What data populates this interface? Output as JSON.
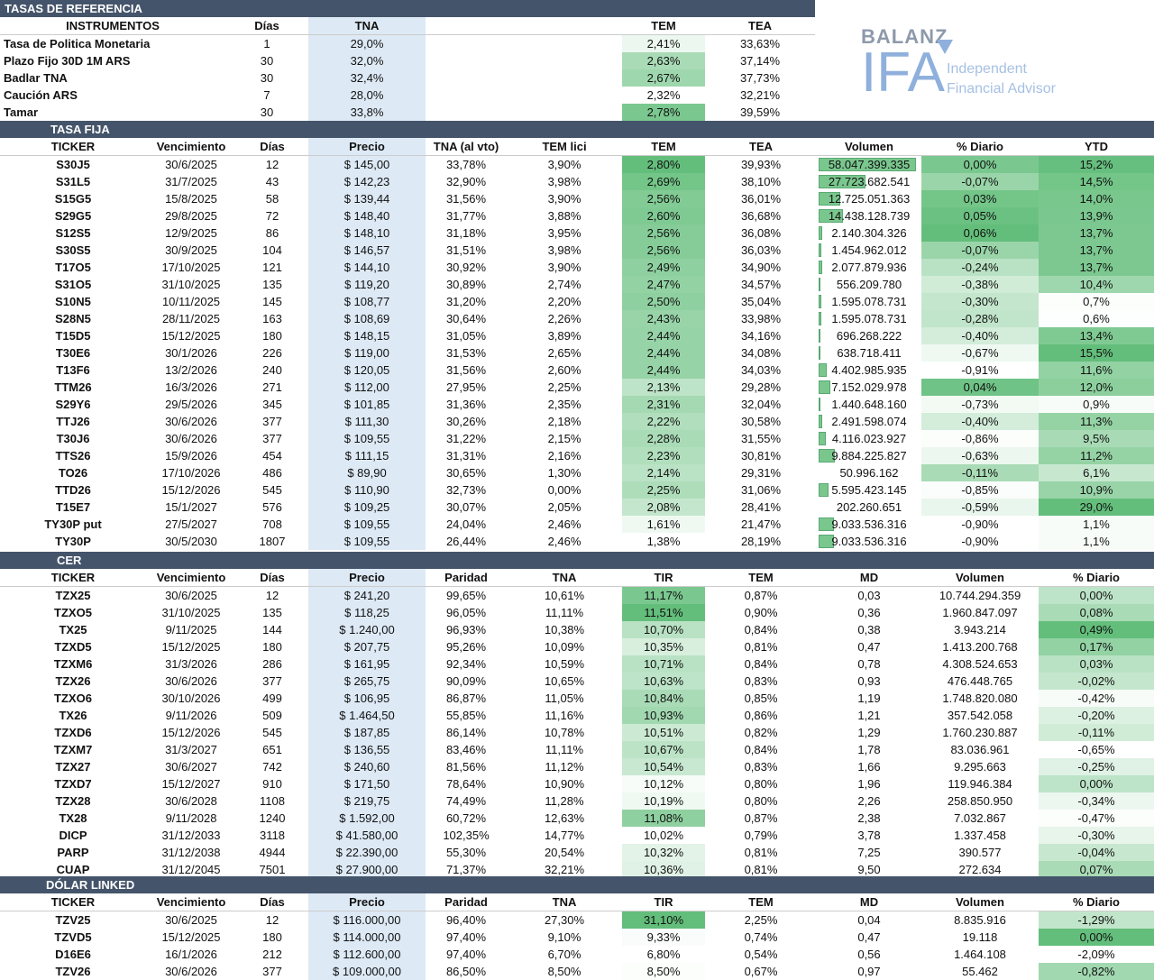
{
  "logo": {
    "brand": "BALANZ",
    "name": "IFA",
    "tagline1": "Independent",
    "tagline2": "Financial Advisor"
  },
  "ref": {
    "title": "TASAS DE REFERENCIA",
    "headers": [
      "INSTRUMENTOS",
      "Días",
      "TNA",
      "",
      "TEM",
      "TEA"
    ],
    "rows": [
      [
        "Tasa de Politica Monetaria",
        "1",
        "29,0%",
        "",
        "2,41%",
        "33,63%"
      ],
      [
        "Plazo Fijo 30D 1M ARS",
        "30",
        "32,0%",
        "",
        "2,63%",
        "37,14%"
      ],
      [
        "Badlar TNA",
        "30",
        "32,4%",
        "",
        "2,67%",
        "37,73%"
      ],
      [
        "Caución ARS",
        "7",
        "28,0%",
        "",
        "2,32%",
        "32,21%"
      ],
      [
        "Tamar",
        "30",
        "33,8%",
        "",
        "2,78%",
        "39,59%"
      ]
    ],
    "tem_shade": [
      0.12,
      0.55,
      0.62,
      0.0,
      0.85
    ]
  },
  "fija": {
    "title": "TASA FIJA",
    "headers": [
      "TICKER",
      "Vencimiento",
      "Días",
      "Precio",
      "TNA (al vto)",
      "TEM lici",
      "TEM",
      "TEA",
      "Volumen",
      "% Diario",
      "YTD"
    ],
    "rows": [
      [
        "S30J5",
        "30/6/2025",
        "12",
        "$ 145,00",
        "33,78%",
        "3,90%",
        "2,80%",
        "39,93%",
        "58.047.399.335",
        "0,00%",
        "15,2%"
      ],
      [
        "S31L5",
        "31/7/2025",
        "43",
        "$ 142,23",
        "32,90%",
        "3,98%",
        "2,69%",
        "38,10%",
        "27.723.682.541",
        "-0,07%",
        "14,5%"
      ],
      [
        "S15G5",
        "15/8/2025",
        "58",
        "$ 139,44",
        "31,56%",
        "3,90%",
        "2,56%",
        "36,01%",
        "12.725.051.363",
        "0,03%",
        "14,0%"
      ],
      [
        "S29G5",
        "29/8/2025",
        "72",
        "$ 148,40",
        "31,77%",
        "3,88%",
        "2,60%",
        "36,68%",
        "14.438.128.739",
        "0,05%",
        "13,9%"
      ],
      [
        "S12S5",
        "12/9/2025",
        "86",
        "$ 148,10",
        "31,18%",
        "3,95%",
        "2,56%",
        "36,08%",
        "2.140.304.326",
        "0,06%",
        "13,7%"
      ],
      [
        "S30S5",
        "30/9/2025",
        "104",
        "$ 146,57",
        "31,51%",
        "3,98%",
        "2,56%",
        "36,03%",
        "1.454.962.012",
        "-0,07%",
        "13,7%"
      ],
      [
        "T17O5",
        "17/10/2025",
        "121",
        "$ 144,10",
        "30,92%",
        "3,90%",
        "2,49%",
        "34,90%",
        "2.077.879.936",
        "-0,24%",
        "13,7%"
      ],
      [
        "S31O5",
        "31/10/2025",
        "135",
        "$ 119,20",
        "30,89%",
        "2,74%",
        "2,47%",
        "34,57%",
        "556.209.780",
        "-0,38%",
        "10,4%"
      ],
      [
        "S10N5",
        "10/11/2025",
        "145",
        "$ 108,77",
        "31,20%",
        "2,20%",
        "2,50%",
        "35,04%",
        "1.595.078.731",
        "-0,30%",
        "0,7%"
      ],
      [
        "S28N5",
        "28/11/2025",
        "163",
        "$ 108,69",
        "30,64%",
        "2,26%",
        "2,43%",
        "33,98%",
        "1.595.078.731",
        "-0,28%",
        "0,6%"
      ],
      [
        "T15D5",
        "15/12/2025",
        "180",
        "$ 148,15",
        "31,05%",
        "3,89%",
        "2,44%",
        "34,16%",
        "696.268.222",
        "-0,40%",
        "13,4%"
      ],
      [
        "T30E6",
        "30/1/2026",
        "226",
        "$ 119,00",
        "31,53%",
        "2,65%",
        "2,44%",
        "34,08%",
        "638.718.411",
        "-0,67%",
        "15,5%"
      ],
      [
        "T13F6",
        "13/2/2026",
        "240",
        "$ 120,05",
        "31,56%",
        "2,60%",
        "2,44%",
        "34,03%",
        "4.402.985.935",
        "-0,91%",
        "11,6%"
      ],
      [
        "TTM26",
        "16/3/2026",
        "271",
        "$ 112,00",
        "27,95%",
        "2,25%",
        "2,13%",
        "29,28%",
        "7.152.029.978",
        "0,04%",
        "12,0%"
      ],
      [
        "S29Y6",
        "29/5/2026",
        "345",
        "$ 101,85",
        "31,36%",
        "2,35%",
        "2,31%",
        "32,04%",
        "1.440.648.160",
        "-0,73%",
        "0,9%"
      ],
      [
        "TTJ26",
        "30/6/2026",
        "377",
        "$ 111,30",
        "30,26%",
        "2,18%",
        "2,22%",
        "30,58%",
        "2.491.598.074",
        "-0,40%",
        "11,3%"
      ],
      [
        "T30J6",
        "30/6/2026",
        "377",
        "$ 109,55",
        "31,22%",
        "2,15%",
        "2,28%",
        "31,55%",
        "4.116.023.927",
        "-0,86%",
        "9,5%"
      ],
      [
        "TTS26",
        "15/9/2026",
        "454",
        "$ 111,15",
        "31,31%",
        "2,16%",
        "2,23%",
        "30,81%",
        "9.884.225.827",
        "-0,63%",
        "11,2%"
      ],
      [
        "TO26",
        "17/10/2026",
        "486",
        "$ 89,90",
        "30,65%",
        "1,30%",
        "2,14%",
        "29,31%",
        "50.996.162",
        "-0,11%",
        "6,1%"
      ],
      [
        "TTD26",
        "15/12/2026",
        "545",
        "$ 110,90",
        "32,73%",
        "0,00%",
        "2,25%",
        "31,06%",
        "5.595.423.145",
        "-0,85%",
        "10,9%"
      ],
      [
        "T15E7",
        "15/1/2027",
        "576",
        "$ 109,25",
        "30,07%",
        "2,05%",
        "2,08%",
        "28,41%",
        "202.260.651",
        "-0,59%",
        "29,0%"
      ],
      [
        "TY30P put",
        "27/5/2027",
        "708",
        "$ 109,55",
        "24,04%",
        "2,46%",
        "1,61%",
        "21,47%",
        "9.033.536.316",
        "-0,90%",
        "1,1%"
      ],
      [
        "TY30P",
        "30/5/2030",
        "1807",
        "$ 109,55",
        "26,44%",
        "2,46%",
        "1,38%",
        "28,19%",
        "9.033.536.316",
        "-0,90%",
        "1,1%"
      ]
    ],
    "tem_shade": [
      1.0,
      0.9,
      0.8,
      0.82,
      0.78,
      0.78,
      0.72,
      0.7,
      0.72,
      0.66,
      0.67,
      0.67,
      0.67,
      0.42,
      0.58,
      0.5,
      0.55,
      0.5,
      0.44,
      0.52,
      0.38,
      0.1,
      0.0
    ],
    "vol_frac": [
      1.0,
      0.48,
      0.22,
      0.25,
      0.04,
      0.03,
      0.04,
      0.01,
      0.03,
      0.03,
      0.01,
      0.01,
      0.08,
      0.12,
      0.02,
      0.04,
      0.07,
      0.17,
      0.0,
      0.1,
      0.0,
      0.16,
      0.16
    ],
    "diario_shade": [
      0.85,
      0.65,
      0.9,
      0.95,
      1.0,
      0.65,
      0.45,
      0.3,
      0.38,
      0.4,
      0.28,
      0.1,
      0.0,
      0.92,
      0.08,
      0.28,
      0.02,
      0.12,
      0.55,
      0.03,
      0.14,
      0.0,
      0.0
    ],
    "ytd_shade": [
      0.98,
      0.9,
      0.86,
      0.85,
      0.84,
      0.84,
      0.84,
      0.62,
      0.02,
      0.01,
      0.82,
      1.0,
      0.7,
      0.74,
      0.05,
      0.68,
      0.56,
      0.68,
      0.36,
      0.66,
      1.0,
      0.05,
      0.05
    ]
  },
  "cer": {
    "title": "CER",
    "headers": [
      "TICKER",
      "Vencimiento",
      "Días",
      "Precio",
      "Paridad",
      "TNA",
      "TIR",
      "TEM",
      "MD",
      "Volumen",
      "% Diario"
    ],
    "rows": [
      [
        "TZX25",
        "30/6/2025",
        "12",
        "$ 241,20",
        "99,65%",
        "10,61%",
        "11,17%",
        "0,87%",
        "0,03",
        "10.744.294.359",
        "0,00%"
      ],
      [
        "TZXO5",
        "31/10/2025",
        "135",
        "$ 118,25",
        "96,05%",
        "11,11%",
        "11,51%",
        "0,90%",
        "0,36",
        "1.960.847.097",
        "0,08%"
      ],
      [
        "TX25",
        "9/11/2025",
        "144",
        "$ 1.240,00",
        "96,93%",
        "10,38%",
        "10,70%",
        "0,84%",
        "0,38",
        "3.943.214",
        "0,49%"
      ],
      [
        "TZXD5",
        "15/12/2025",
        "180",
        "$ 207,75",
        "95,26%",
        "10,09%",
        "10,35%",
        "0,81%",
        "0,47",
        "1.413.200.768",
        "0,17%"
      ],
      [
        "TZXM6",
        "31/3/2026",
        "286",
        "$ 161,95",
        "92,34%",
        "10,59%",
        "10,71%",
        "0,84%",
        "0,78",
        "4.308.524.653",
        "0,03%"
      ],
      [
        "TZX26",
        "30/6/2026",
        "377",
        "$ 265,75",
        "90,09%",
        "10,65%",
        "10,63%",
        "0,83%",
        "0,93",
        "476.448.765",
        "-0,02%"
      ],
      [
        "TZXO6",
        "30/10/2026",
        "499",
        "$ 106,95",
        "86,87%",
        "11,05%",
        "10,84%",
        "0,85%",
        "1,19",
        "1.748.820.080",
        "-0,42%"
      ],
      [
        "TX26",
        "9/11/2026",
        "509",
        "$ 1.464,50",
        "55,85%",
        "11,16%",
        "10,93%",
        "0,86%",
        "1,21",
        "357.542.058",
        "-0,20%"
      ],
      [
        "TZXD6",
        "15/12/2026",
        "545",
        "$ 187,85",
        "86,14%",
        "10,78%",
        "10,51%",
        "0,82%",
        "1,29",
        "1.760.230.887",
        "-0,11%"
      ],
      [
        "TZXM7",
        "31/3/2027",
        "651",
        "$ 136,55",
        "83,46%",
        "11,11%",
        "10,67%",
        "0,84%",
        "1,78",
        "83.036.961",
        "-0,65%"
      ],
      [
        "TZX27",
        "30/6/2027",
        "742",
        "$ 240,60",
        "81,56%",
        "11,12%",
        "10,54%",
        "0,83%",
        "1,66",
        "9.295.663",
        "-0,25%"
      ],
      [
        "TZXD7",
        "15/12/2027",
        "910",
        "$ 171,50",
        "78,64%",
        "10,90%",
        "10,12%",
        "0,80%",
        "1,96",
        "119.946.384",
        "0,00%"
      ],
      [
        "TZX28",
        "30/6/2028",
        "1108",
        "$ 219,75",
        "74,49%",
        "11,28%",
        "10,19%",
        "0,80%",
        "2,26",
        "258.850.950",
        "-0,34%"
      ],
      [
        "TX28",
        "9/11/2028",
        "1240",
        "$ 1.592,00",
        "60,72%",
        "12,63%",
        "11,08%",
        "0,87%",
        "2,38",
        "7.032.867",
        "-0,47%"
      ],
      [
        "DICP",
        "31/12/2033",
        "3118",
        "$ 41.580,00",
        "102,35%",
        "14,77%",
        "10,02%",
        "0,79%",
        "3,78",
        "1.337.458",
        "-0,30%"
      ],
      [
        "PARP",
        "31/12/2038",
        "4944",
        "$ 22.390,00",
        "55,30%",
        "20,54%",
        "10,32%",
        "0,81%",
        "7,25",
        "390.577",
        "-0,04%"
      ],
      [
        "CUAP",
        "31/12/2045",
        "7501",
        "$ 27.900,00",
        "71,37%",
        "32,21%",
        "10,36%",
        "0,81%",
        "9,50",
        "272.634",
        "0,07%"
      ]
    ],
    "tir_shade": [
      0.85,
      1.0,
      0.45,
      0.25,
      0.45,
      0.42,
      0.55,
      0.6,
      0.33,
      0.43,
      0.35,
      0.05,
      0.1,
      0.72,
      0.0,
      0.18,
      0.2
    ],
    "diario_shade": [
      0.42,
      0.55,
      1.0,
      0.7,
      0.45,
      0.38,
      0.05,
      0.22,
      0.3,
      0.0,
      0.2,
      0.42,
      0.12,
      0.02,
      0.15,
      0.36,
      0.55
    ]
  },
  "dolar": {
    "title": "DÓLAR LINKED",
    "headers": [
      "TICKER",
      "Vencimiento",
      "Días",
      "Precio",
      "Paridad",
      "TNA",
      "TIR",
      "TEM",
      "MD",
      "Volumen",
      "% Diario"
    ],
    "rows": [
      [
        "TZV25",
        "30/6/2025",
        "12",
        "$ 116.000,00",
        "96,40%",
        "27,30%",
        "31,10%",
        "2,25%",
        "0,04",
        "8.835.916",
        "-1,29%"
      ],
      [
        "TZVD5",
        "15/12/2025",
        "180",
        "$ 114.000,00",
        "97,40%",
        "9,10%",
        "9,33%",
        "0,74%",
        "0,47",
        "19.118",
        "0,00%"
      ],
      [
        "D16E6",
        "16/1/2026",
        "212",
        "$ 112.600,00",
        "97,40%",
        "6,70%",
        "6,80%",
        "0,54%",
        "0,56",
        "1.464.108",
        "-2,09%"
      ],
      [
        "TZV26",
        "30/6/2026",
        "377",
        "$ 109.000,00",
        "86,50%",
        "8,50%",
        "8,50%",
        "0,67%",
        "0,97",
        "55.462",
        "-0,82%"
      ]
    ],
    "tir_shade": [
      1.0,
      0.04,
      0.0,
      0.02
    ],
    "diario_shade": [
      0.4,
      1.0,
      0.0,
      0.6
    ]
  }
}
